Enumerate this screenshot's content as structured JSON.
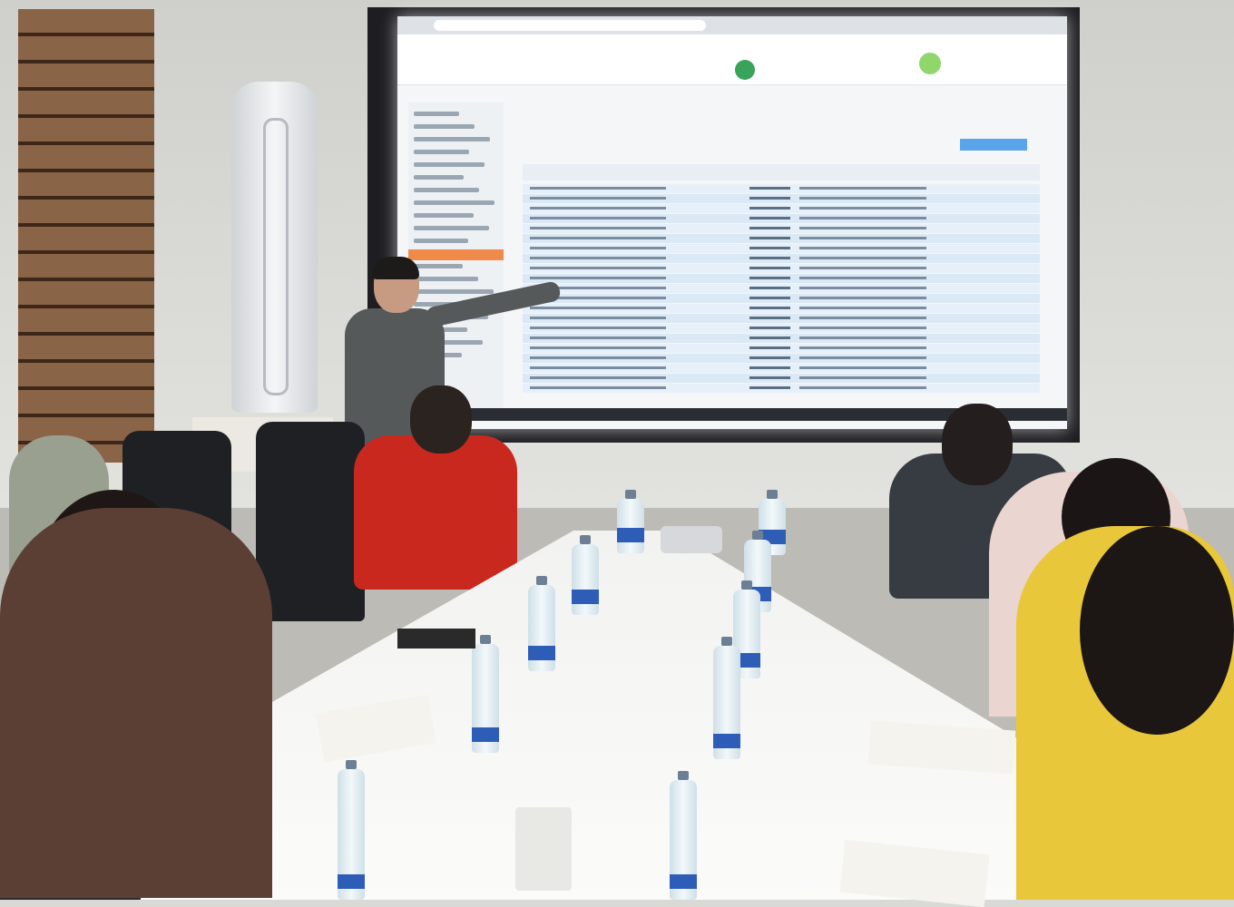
{
  "scene": {
    "description_type": "photo",
    "colors": {
      "screen_background": "#f4f6f8",
      "sidebar_active": "#f08a4b",
      "button_accent": "#5aa5ea",
      "logo_text": "#2f7fc4"
    }
  }
}
